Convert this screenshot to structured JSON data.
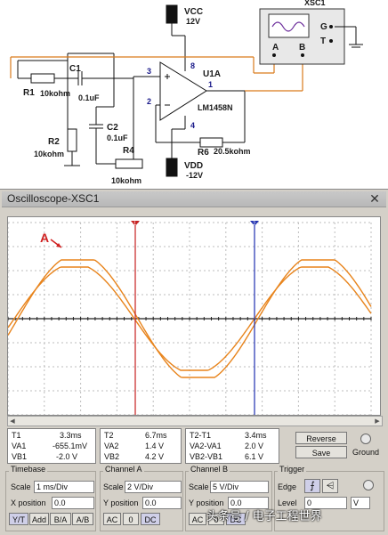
{
  "schematic": {
    "vcc_label": "VCC",
    "vcc_value": "12V",
    "vdd_label": "VDD",
    "vdd_value": "-12V",
    "r1_name": "R1",
    "r1_value": "10kohm",
    "c1_name": "C1",
    "c1_value": "0.1uF",
    "r2_name": "R2",
    "r2_value": "10kohm",
    "c2_name": "C2",
    "c2_value": "0.1uF",
    "r4_name": "R4",
    "r4_value": "10kohm",
    "r6_name": "R6",
    "r6_value": "20.5kohm",
    "opamp_name": "U1A",
    "opamp_part": "LM1458N",
    "pin3": "3",
    "pin2": "2",
    "pin8": "8",
    "pin4": "4",
    "pin1": "1",
    "xsc_label": "XSC1",
    "xsc_a": "A",
    "xsc_b": "B",
    "xsc_g": "G",
    "xsc_t": "T"
  },
  "oscilloscope": {
    "title": "Oscilloscope-XSC1",
    "close_glyph": "✕",
    "annotation": "A",
    "scroll_left": "◀",
    "scroll_right": "▶",
    "cursor_table_1": {
      "labels": [
        "T1",
        "VA1",
        "VB1"
      ],
      "values": [
        "3.3ms",
        "-655.1mV",
        "-2.0 V"
      ]
    },
    "cursor_table_2": {
      "labels": [
        "T2",
        "VA2",
        "VB2"
      ],
      "values": [
        "6.7ms",
        "1.4 V",
        "4.2 V"
      ]
    },
    "cursor_table_3": {
      "labels": [
        "T2-T1",
        "VA2-VA1",
        "VB2-VB1"
      ],
      "values": [
        "3.4ms",
        "2.0 V",
        "6.1 V"
      ]
    },
    "reverse_label": "Reverse",
    "save_label": "Save",
    "ground_label": "Ground",
    "timebase": {
      "title": "Timebase",
      "scale_label": "Scale",
      "scale_value": "1 ms/Div",
      "xpos_label": "X position",
      "xpos_value": "0.0",
      "modes": [
        "Y/T",
        "Add",
        "B/A",
        "A/B"
      ]
    },
    "channel_a": {
      "title": "Channel A",
      "scale_label": "Scale",
      "scale_value": "2 V/Div",
      "ypos_label": "Y position",
      "ypos_value": "0.0",
      "coupling": [
        "AC",
        "0",
        "DC"
      ]
    },
    "channel_b": {
      "title": "Channel B",
      "scale_label": "Scale",
      "scale_value": "5 V/Div",
      "ypos_label": "Y position",
      "ypos_value": "0.0",
      "coupling": [
        "AC",
        "0",
        "DC"
      ]
    },
    "trigger": {
      "title": "Trigger",
      "edge_label": "Edge",
      "level_label": "Level",
      "level_value": "0",
      "level_unit": "V"
    },
    "colors": {
      "trace": "#e8841c",
      "cursor1": "#c62020",
      "cursor2": "#2030b0"
    }
  },
  "watermark": "头条号 / 电子工程世界"
}
